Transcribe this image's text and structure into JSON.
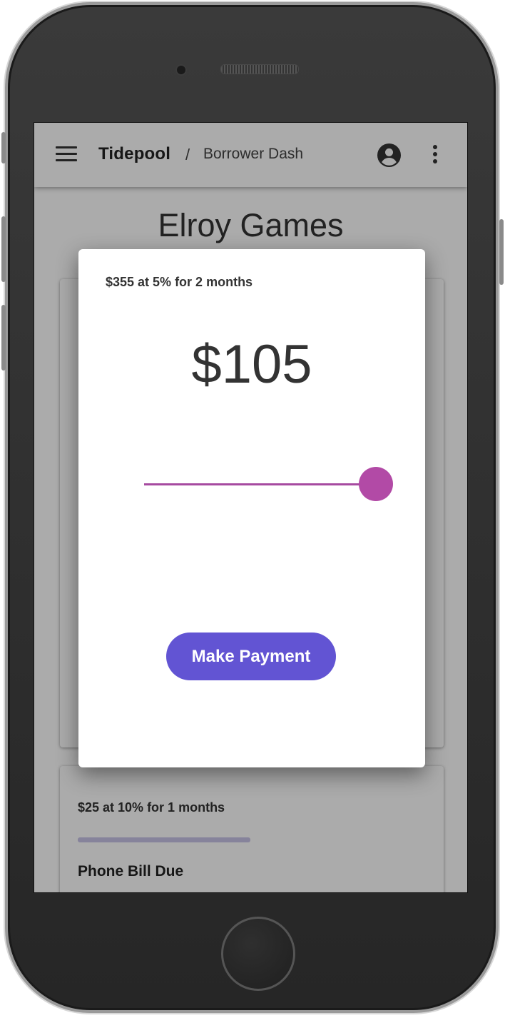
{
  "appbar": {
    "brand": "Tidepool",
    "separator": "/",
    "breadcrumb": "Borrower Dash",
    "menu_icon": "hamburger-menu-icon",
    "account_icon": "account-circle-icon",
    "more_icon": "more-vertical-icon"
  },
  "page": {
    "title": "Elroy Games"
  },
  "loan_cards": [
    {},
    {
      "summary": "$25 at 10% for 1 months",
      "name": "Phone Bill Due",
      "progress": 0.45
    }
  ],
  "dialog": {
    "summary": "$355 at 5% for 2 months",
    "amount": "$105",
    "slider_fraction": 1.0,
    "pay_label": "Make Payment"
  },
  "colors": {
    "accent": "#6254d3",
    "slider": "#b24aa6",
    "progress_track": "#c8c4e8"
  }
}
